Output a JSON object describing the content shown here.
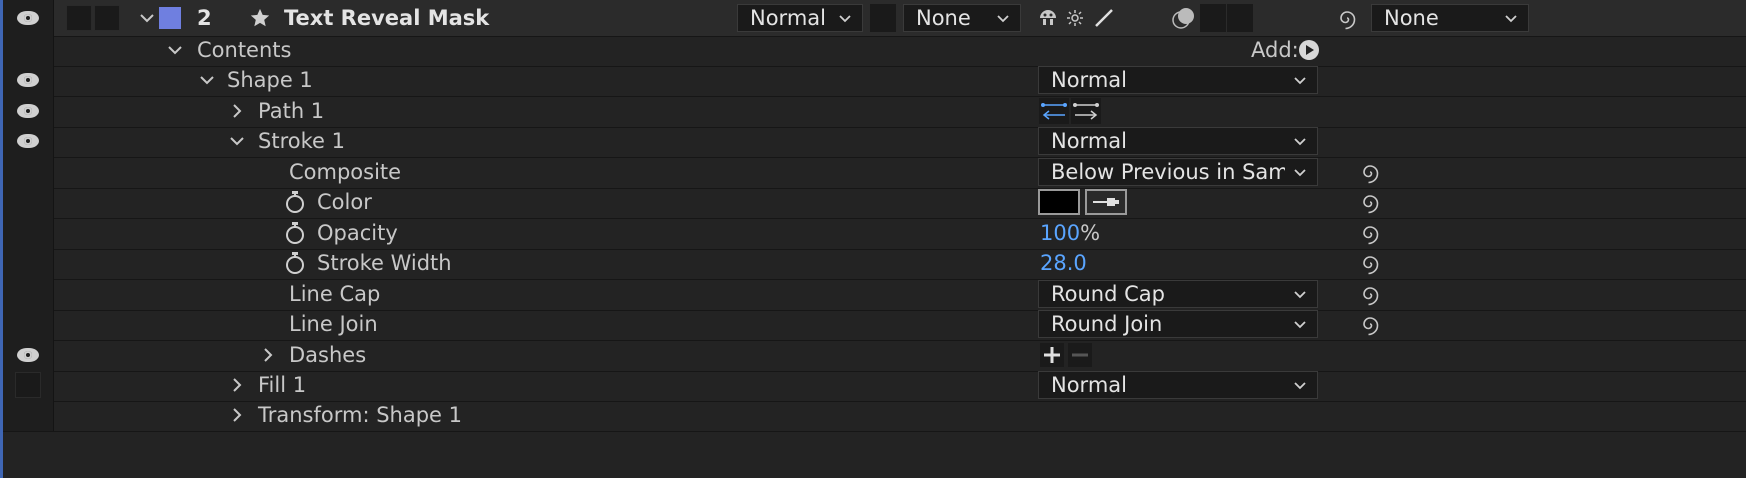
{
  "layer": {
    "number": "2",
    "name": "Text Reveal Mask",
    "label_color": "#6f7fe0",
    "mode": "Normal",
    "track_matte": "None",
    "parent": "None"
  },
  "add_label": "Add:",
  "rows": {
    "contents": "Contents",
    "shape1": "Shape 1",
    "shape1_mode": "Normal",
    "path1": "Path 1",
    "stroke1": "Stroke 1",
    "stroke1_mode": "Normal",
    "composite": "Composite",
    "composite_value": "Below Previous in Same Gr",
    "color": "Color",
    "opacity": "Opacity",
    "opacity_value": "100",
    "opacity_unit": "%",
    "stroke_width": "Stroke Width",
    "stroke_width_value": "28.0",
    "line_cap": "Line Cap",
    "line_cap_value": "Round Cap",
    "line_join": "Line Join",
    "line_join_value": "Round Join",
    "dashes": "Dashes",
    "fill1": "Fill 1",
    "fill1_mode": "Normal",
    "transform": "Transform: Shape 1"
  },
  "colors": {
    "accent_blue": "#5aa5ff",
    "stroke_color": "#000000"
  }
}
